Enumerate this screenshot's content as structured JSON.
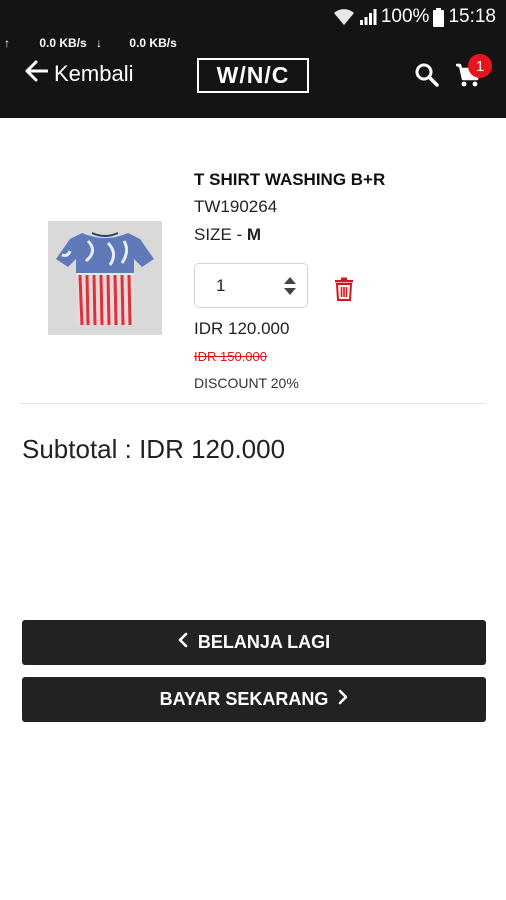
{
  "status_bar": {
    "battery": "100%",
    "time": "15:18"
  },
  "network": {
    "up_speed": "0.0 KB/s",
    "down_speed": "0.0 KB/s"
  },
  "app_bar": {
    "back_label": "Kembali",
    "logo_text": "W/N/C",
    "cart_count": "1"
  },
  "cart": {
    "item": {
      "name": "T SHIRT WASHING B+R",
      "code": "TW190264",
      "size_label": "SIZE - ",
      "size_value": "M",
      "quantity": "1",
      "price": "IDR 120.000",
      "original_price": "IDR 150.000",
      "discount": "DISCOUNT 20%"
    },
    "subtotal": "Subtotal : IDR 120.000"
  },
  "actions": {
    "continue_shopping": "BELANJA LAGI",
    "pay_now": "BAYAR SEKARANG"
  },
  "colors": {
    "header_bg": "#141414",
    "button_bg": "#222222",
    "badge": "#e8141c",
    "trash": "#d8141c"
  }
}
